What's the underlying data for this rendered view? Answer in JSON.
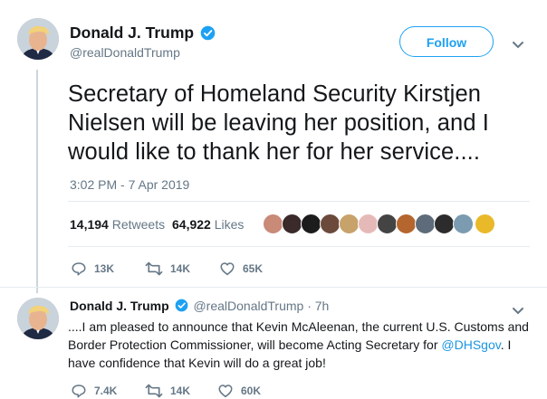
{
  "tweet": {
    "author_name": "Donald J. Trump",
    "author_handle": "@realDonaldTrump",
    "follow_label": "Follow",
    "text": "Secretary of Homeland Security Kirstjen Nielsen will be leaving her position, and I would like to thank her for her service....",
    "timestamp": "3:02 PM - 7 Apr 2019",
    "retweets_count": "14,194",
    "retweets_label": "Retweets",
    "likes_count": "64,922",
    "likes_label": "Likes",
    "replies": "13K",
    "retweets_short": "14K",
    "likes_short": "65K"
  },
  "reply": {
    "author_name": "Donald J. Trump",
    "author_handle": "@realDonaldTrump",
    "time_ago": "· 7h",
    "text_part1": "....I am pleased to announce that Kevin McAleenan, the current U.S. Customs and Border Protection Commissioner, will become Acting Secretary for ",
    "mention": "@DHSgov",
    "text_part2": ". I have confidence that Kevin will do a great job!",
    "replies": "7.4K",
    "retweets": "14K",
    "likes": "60K"
  },
  "colors": {
    "accent": "#1da1f2",
    "link": "#1b95e0",
    "muted": "#657786",
    "text": "#14171a",
    "divider": "#e6ecf0"
  },
  "icons": [
    "verified-badge-icon",
    "chevron-down-icon",
    "reply-icon",
    "retweet-icon",
    "like-icon"
  ]
}
